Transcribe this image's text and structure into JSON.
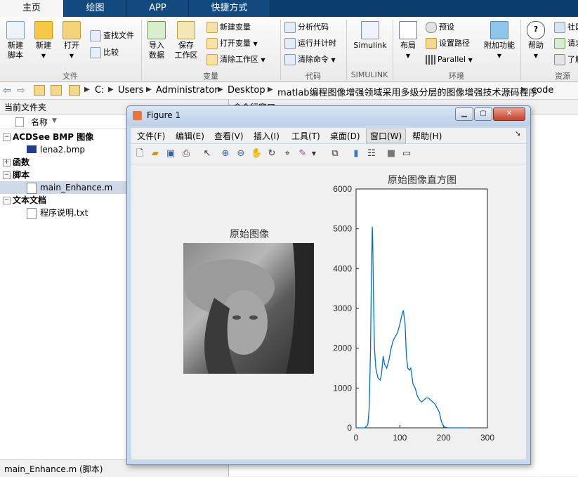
{
  "tabs": [
    "主页",
    "绘图",
    "APP",
    "快捷方式"
  ],
  "ribbon": {
    "new_script": "新建\n脚本",
    "new": "新建",
    "open": "打开",
    "find_files": "查找文件",
    "compare": "比较",
    "import_data": "导入\n数据",
    "save_workspace": "保存\n工作区",
    "new_variable": "新建变量",
    "open_variable": "打开变量",
    "clear_workspace": "清除工作区",
    "analyze_code": "分析代码",
    "run_and_time": "运行并计时",
    "clear_commands": "清除命令",
    "simulink": "Simulink",
    "layout": "布局",
    "preferences": "预设",
    "set_path": "设置路径",
    "parallel": "Parallel",
    "addons": "附加功能",
    "help": "帮助",
    "community": "社区",
    "request_support": "请求支持",
    "learn": "了解",
    "groups": [
      "文件",
      "变量",
      "代码",
      "SIMULINK",
      "环境",
      "资源"
    ]
  },
  "address": {
    "crumbs": [
      "C:",
      "Users",
      "Administrator",
      "Desktop",
      "matlab编程图像增强领域采用多级分层的图像增强技术源码程序",
      "code"
    ]
  },
  "left_panel": {
    "title": "当前文件夹",
    "col_name": "名称",
    "groups": [
      {
        "label": "ACDSee BMP 图像",
        "files": [
          "lena2.bmp"
        ]
      },
      {
        "label": "函数",
        "files": []
      },
      {
        "label": "脚本",
        "files": [
          "main_Enhance.m"
        ]
      },
      {
        "label": "文本文档",
        "files": [
          "程序说明.txt"
        ]
      }
    ],
    "status": "main_Enhance.m  (脚本)"
  },
  "right_panel": {
    "title": "命令行窗口"
  },
  "figure": {
    "title": "Figure 1",
    "menus": [
      "文件(F)",
      "编辑(E)",
      "查看(V)",
      "插入(I)",
      "工具(T)",
      "桌面(D)",
      "窗口(W)",
      "帮助(H)"
    ],
    "image_title": "原始图像",
    "hist_title": "原始图像直方图"
  },
  "chart_data": {
    "type": "line",
    "title": "原始图像直方图",
    "xlabel": "",
    "ylabel": "",
    "xlim": [
      0,
      300
    ],
    "ylim": [
      0,
      6000
    ],
    "xticks": [
      0,
      100,
      200,
      300
    ],
    "yticks": [
      0,
      1000,
      2000,
      3000,
      4000,
      5000,
      6000
    ],
    "x": [
      0,
      20,
      27,
      30,
      33,
      35,
      37,
      38,
      40,
      42,
      45,
      50,
      55,
      58,
      62,
      65,
      70,
      75,
      80,
      85,
      90,
      95,
      100,
      105,
      108,
      112,
      115,
      118,
      122,
      125,
      130,
      135,
      140,
      145,
      150,
      155,
      160,
      165,
      170,
      175,
      180,
      185,
      190,
      195,
      200,
      205,
      210,
      230,
      250,
      255
    ],
    "y": [
      0,
      0,
      80,
      500,
      2000,
      3800,
      5050,
      4700,
      3200,
      2000,
      1500,
      1250,
      1200,
      1350,
      1800,
      1600,
      1500,
      1700,
      2000,
      2200,
      2300,
      2400,
      2600,
      2850,
      2950,
      2600,
      1800,
      1500,
      1450,
      1500,
      1100,
      1000,
      800,
      700,
      650,
      700,
      750,
      750,
      700,
      650,
      600,
      500,
      400,
      150,
      30,
      10,
      0,
      0,
      0,
      0
    ]
  }
}
